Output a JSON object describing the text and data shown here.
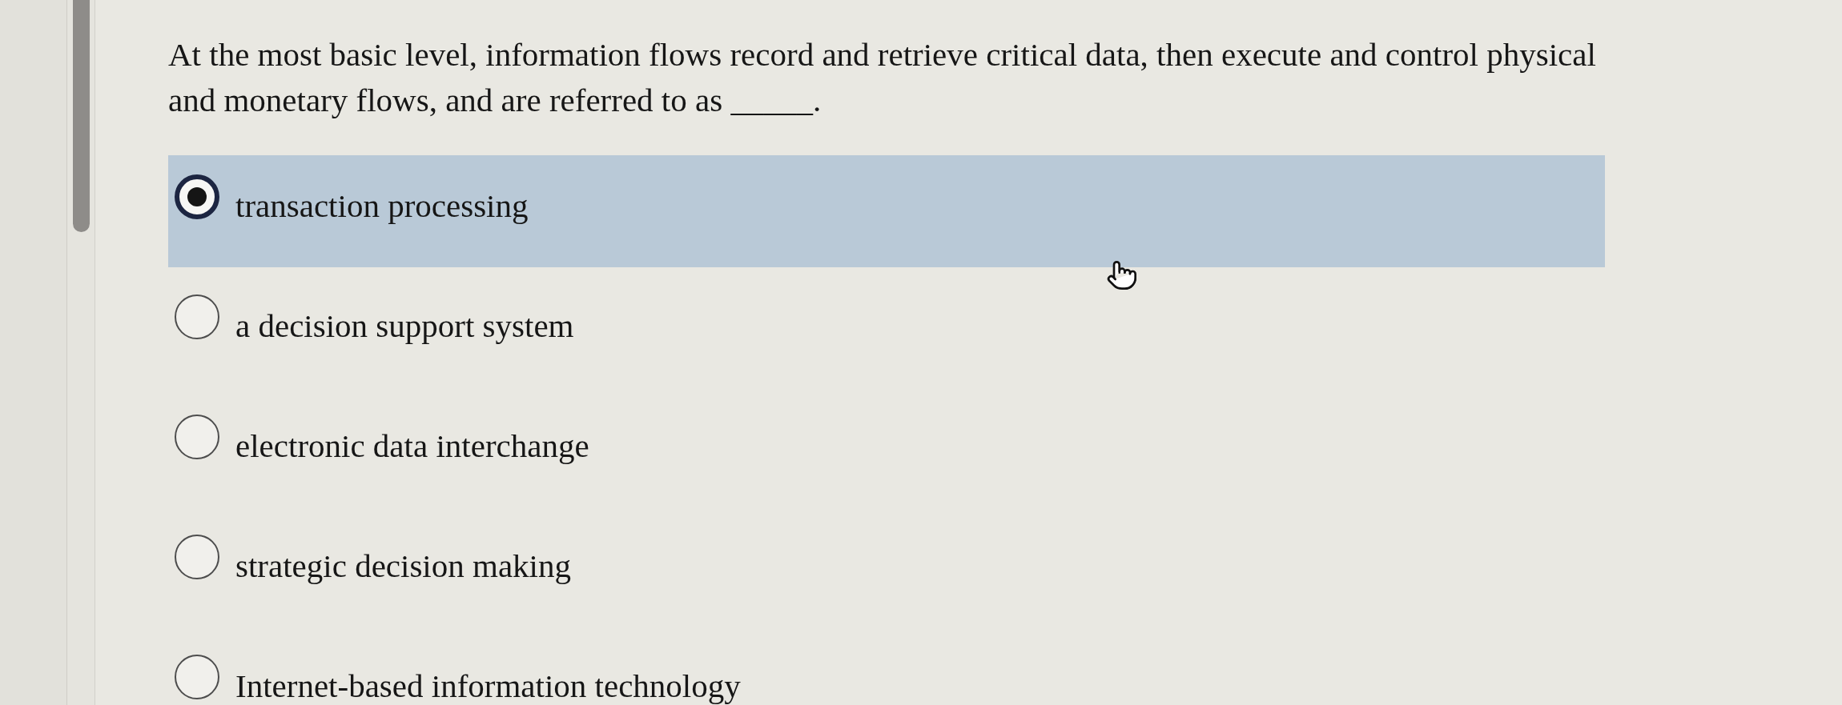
{
  "question": "At the most basic level, information flows record and retrieve critical data, then execute and control physical and monetary flows, and are referred to as _____.",
  "options": [
    {
      "label": "transaction processing",
      "selected": true
    },
    {
      "label": "a decision support system",
      "selected": false
    },
    {
      "label": "electronic data interchange",
      "selected": false
    },
    {
      "label": "strategic decision making",
      "selected": false
    },
    {
      "label": "Internet-based information technology",
      "selected": false
    }
  ]
}
